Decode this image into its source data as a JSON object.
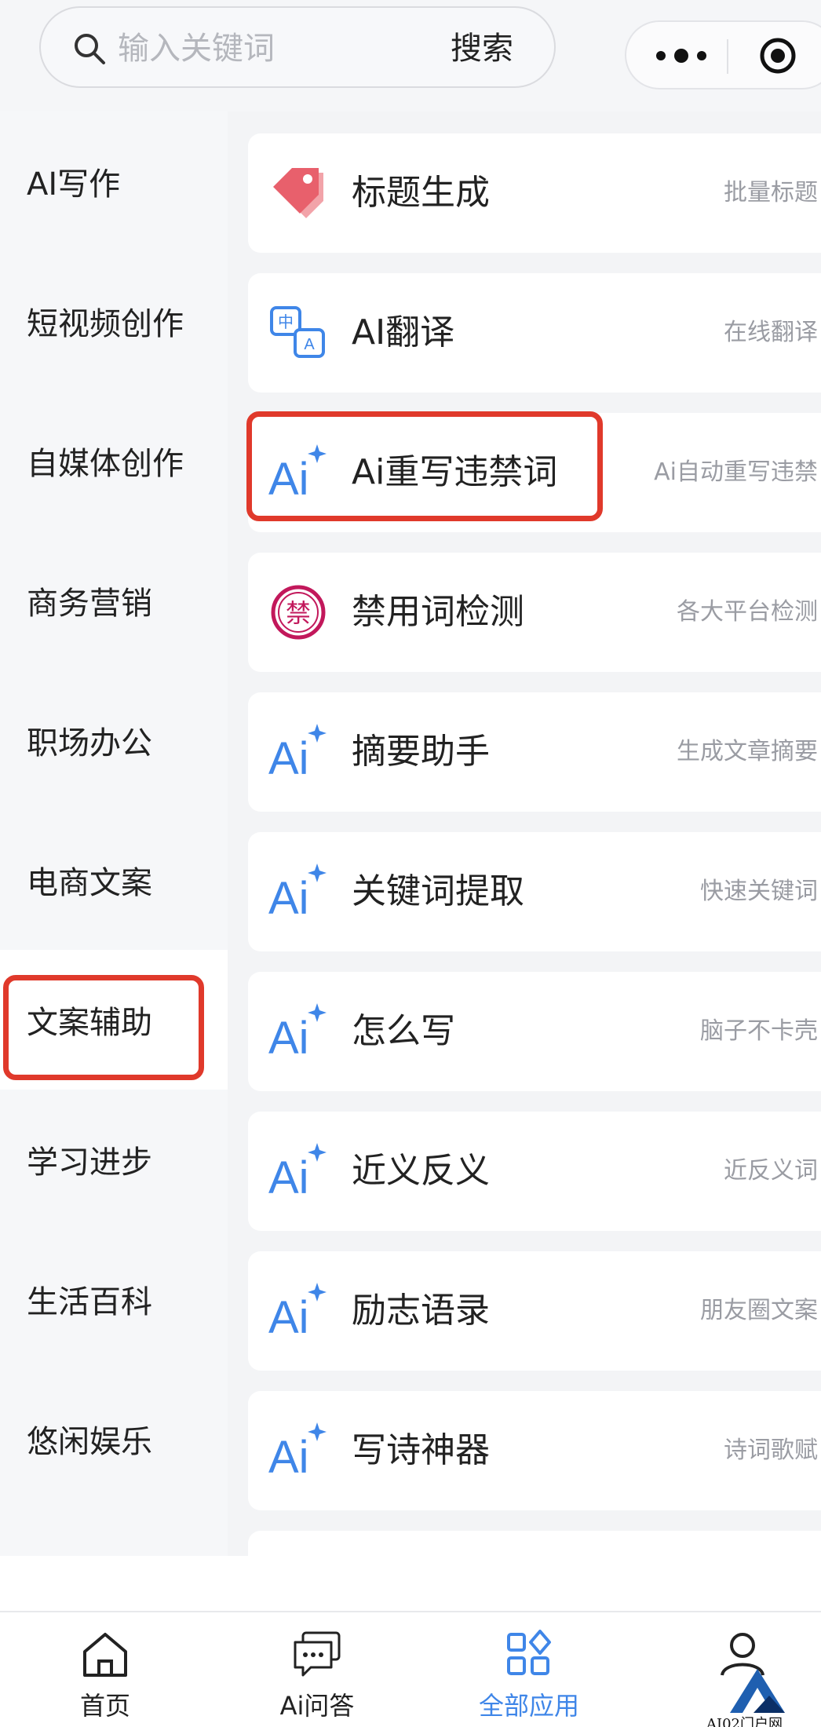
{
  "search": {
    "placeholder": "输入关键词",
    "button_label": "搜索",
    "icon": "search-icon"
  },
  "capsule": {
    "more_icon": "more-dots-icon",
    "close_icon": "target-icon"
  },
  "sidebar": {
    "items": [
      {
        "label": "AI写作"
      },
      {
        "label": "短视频创作"
      },
      {
        "label": "自媒体创作"
      },
      {
        "label": "商务营销"
      },
      {
        "label": "职场办公"
      },
      {
        "label": "电商文案"
      },
      {
        "label": "文案辅助",
        "active": true
      },
      {
        "label": "学习进步"
      },
      {
        "label": "生活百科"
      },
      {
        "label": "悠闲娱乐"
      }
    ]
  },
  "apps": [
    {
      "title": "标题生成",
      "desc": "批量标题",
      "icon": "tag-icon"
    },
    {
      "title": "AI翻译",
      "desc": "在线翻译",
      "icon": "translate-icon"
    },
    {
      "title": "Ai重写违禁词",
      "desc": "Ai自动重写违禁",
      "icon": "ai-sparkle-icon"
    },
    {
      "title": "禁用词检测",
      "desc": "各大平台检测",
      "icon": "forbidden-stamp-icon"
    },
    {
      "title": "摘要助手",
      "desc": "生成文章摘要",
      "icon": "ai-sparkle-icon"
    },
    {
      "title": "关键词提取",
      "desc": "快速关键词",
      "icon": "ai-sparkle-icon"
    },
    {
      "title": "怎么写",
      "desc": "脑子不卡壳",
      "icon": "ai-sparkle-icon"
    },
    {
      "title": "近义反义",
      "desc": "近反义词",
      "icon": "ai-sparkle-icon"
    },
    {
      "title": "励志语录",
      "desc": "朋友圈文案",
      "icon": "ai-sparkle-icon"
    },
    {
      "title": "写诗神器",
      "desc": "诗词歌赋",
      "icon": "ai-sparkle-icon"
    }
  ],
  "ai_icon_text": "Ai",
  "forbidden_char": "禁",
  "translate_glyphs": {
    "zh": "中",
    "en": "A"
  },
  "bottom_nav": [
    {
      "label": "首页",
      "icon": "home-icon"
    },
    {
      "label": "Ai问答",
      "icon": "chat-icon"
    },
    {
      "label": "全部应用",
      "icon": "apps-grid-icon",
      "active": true
    },
    {
      "label": "",
      "icon": "profile-icon"
    }
  ],
  "watermark": {
    "text": "AI02门户网"
  },
  "colors": {
    "accent": "#3f86e8",
    "highlight": "#e0392b",
    "tag": "#e8606c",
    "stamp": "#c2185b"
  }
}
